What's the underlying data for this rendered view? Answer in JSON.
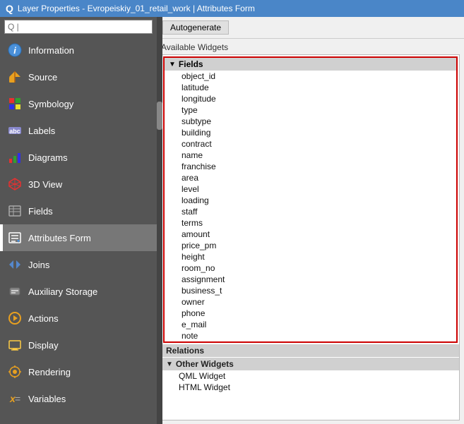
{
  "titleBar": {
    "label": "Layer Properties - Evropeiskiy_01_retail_work | Attributes Form",
    "icon": "Q"
  },
  "sidebar": {
    "searchPlaceholder": "Q |",
    "items": [
      {
        "id": "information",
        "label": "Information",
        "icon": "info"
      },
      {
        "id": "source",
        "label": "Source",
        "icon": "source"
      },
      {
        "id": "symbology",
        "label": "Symbology",
        "icon": "symbology"
      },
      {
        "id": "labels",
        "label": "Labels",
        "icon": "labels"
      },
      {
        "id": "diagrams",
        "label": "Diagrams",
        "icon": "diagrams"
      },
      {
        "id": "3dview",
        "label": "3D View",
        "icon": "3dview"
      },
      {
        "id": "fields",
        "label": "Fields",
        "icon": "fields"
      },
      {
        "id": "attributes-form",
        "label": "Attributes Form",
        "icon": "attributes-form",
        "active": true
      },
      {
        "id": "joins",
        "label": "Joins",
        "icon": "joins"
      },
      {
        "id": "auxiliary-storage",
        "label": "Auxiliary Storage",
        "icon": "auxiliary-storage"
      },
      {
        "id": "actions",
        "label": "Actions",
        "icon": "actions"
      },
      {
        "id": "display",
        "label": "Display",
        "icon": "display"
      },
      {
        "id": "rendering",
        "label": "Rendering",
        "icon": "rendering"
      },
      {
        "id": "variables",
        "label": "Variables",
        "icon": "variables"
      }
    ]
  },
  "rightPanel": {
    "autogenerateLabel": "Autogenerate",
    "availableWidgetsLabel": "Available Widgets",
    "fields": {
      "sectionLabel": "Fields",
      "items": [
        "object_id",
        "latitude",
        "longitude",
        "type",
        "subtype",
        "building",
        "contract",
        "name",
        "franchise",
        "area",
        "level",
        "loading",
        "staff",
        "terms",
        "amount",
        "price_pm",
        "height",
        "room_no",
        "assignment",
        "business_t",
        "owner",
        "phone",
        "e_mail",
        "note"
      ]
    },
    "relationsLabel": "Relations",
    "otherWidgets": {
      "sectionLabel": "Other Widgets",
      "items": [
        "QML Widget",
        "HTML Widget"
      ]
    }
  }
}
